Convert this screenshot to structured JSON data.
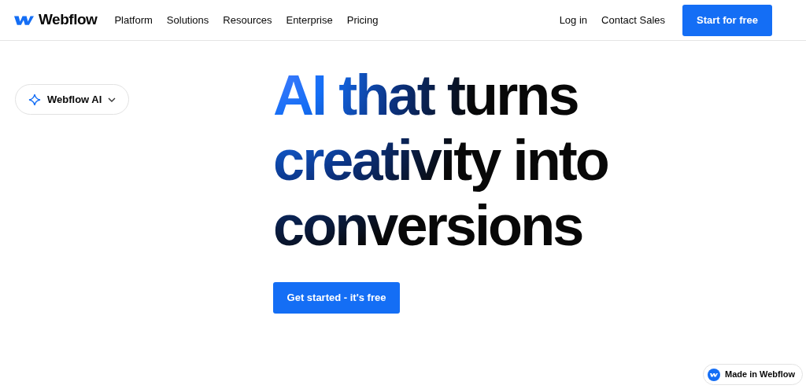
{
  "nav": {
    "brand": "Webflow",
    "links": [
      "Platform",
      "Solutions",
      "Resources",
      "Enterprise",
      "Pricing"
    ],
    "actions": [
      "Log in",
      "Contact Sales"
    ],
    "cta": "Start for free"
  },
  "product_menu": {
    "label": "Webflow AI"
  },
  "hero": {
    "headline_lines": [
      "AI that turns",
      "creativity into",
      "conversions"
    ],
    "cta": "Get started - it's free"
  },
  "badge": {
    "label": "Made in Webflow"
  }
}
